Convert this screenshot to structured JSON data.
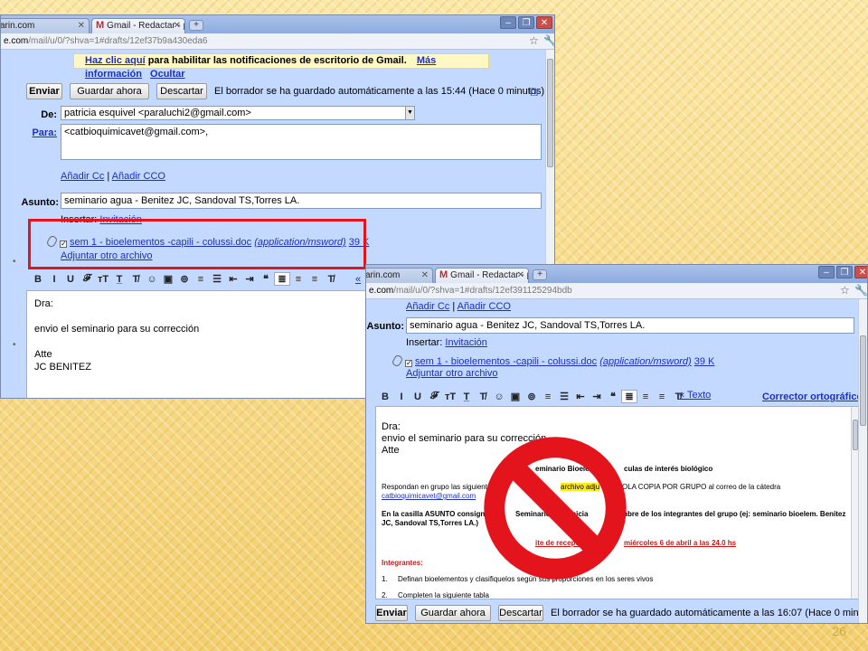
{
  "page_number": "26",
  "window1": {
    "tab_prev": "arin.com",
    "tab_gmail": "Gmail - Redactar - paralu...",
    "url_host": "e.com",
    "url_path": "/mail/u/0/?shva=1#drafts/12ef37b9a430eda6",
    "notification": {
      "link1": "Haz clic aquí",
      "text": "para habilitar las notificaciones de escritorio de Gmail.",
      "link2": "Más información",
      "link3": "Ocultar"
    },
    "actions": {
      "send": "Enviar",
      "save": "Guardar ahora",
      "discard": "Descartar",
      "status": "El borrador se ha guardado automáticamente a las 15:44 (Hace 0 minutos)"
    },
    "from_label": "De:",
    "from_value": "patricia esquivel <paraluchi2@gmail.com>",
    "to_label": "Para:",
    "to_value": "<catbioquimicavet@gmail.com>,",
    "add_cc": "Añadir Cc",
    "sep": "|",
    "add_bcc": "Añadir CCO",
    "subject_label": "Asunto:",
    "subject_value": "seminario agua - Benitez JC, Sandoval TS,Torres LA.",
    "insert_label": "Insertar:",
    "insert_link": "Invitación",
    "attachment_name": "sem 1 - bioelementos -capili - colussi.doc",
    "attachment_type": "(application/msword)",
    "attachment_size": "39 K",
    "attach_another": "Adjuntar otro archivo",
    "toolbar": [
      "B",
      "I",
      "U",
      "𝓕",
      "тT",
      "T̲",
      "T̸",
      "☺",
      "▣",
      "⊚",
      "≡",
      "☰",
      "⇤",
      "⇥",
      "❝",
      "≣",
      "≡",
      "≡",
      "T̸"
    ],
    "text_link": "«",
    "body": [
      "Dra:",
      "envio el seminario para su corrección",
      "Atte",
      "JC BENITEZ"
    ]
  },
  "window2": {
    "tab_prev": "arin.com",
    "tab_gmail": "Gmail - Redactar - paralu...",
    "url_host": "e.com",
    "url_path": "/mail/u/0/?shva=1#drafts/12ef391125294bdb",
    "add_cc": "Añadir Cc",
    "sep": "|",
    "add_bcc": "Añadir CCO",
    "subject_label": "Asunto:",
    "subject_value": "seminario agua - Benitez JC, Sandoval TS,Torres LA.",
    "insert_label": "Insertar:",
    "insert_link": "Invitación",
    "attachment_name": "sem 1 - bioelementos -capili - colussi.doc",
    "attachment_type": "(application/msword)",
    "attachment_size": "39 K",
    "attach_another": "Adjuntar otro archivo",
    "text_link": "« Texto",
    "spellcheck": "Corrector ortográfico ▾",
    "body": {
      "greeting": "Dra:",
      "line1": "envio el seminario para su corrección",
      "sign": "Atte",
      "doc_title_a": "eminario Bioelem",
      "doc_title_b": "culas de interés biológico",
      "doc_p1_a": "Respondan en grupo las siguientes",
      "doc_p1_hl": "archivo adju",
      "doc_p1_b": "OLA COPIA POR GRUPO al correo de la cátedra",
      "doc_email": "catbioquimicavet@gmail.com",
      "doc_p2_a": "En la casilla ASUNTO consignar",
      "doc_p2_b": "Seminario",
      "doc_p2_c": "inicia",
      "doc_p2_d": "ombre  de  los integrantes del grupo (ej: seminario bioelem. Benitez",
      "doc_p2_e": "JC, Sandoval TS,Torres LA.)",
      "doc_deadline_a": "ite de recepc",
      "doc_deadline_b": "miércoles 6 de abril a las  24.0 hs",
      "doc_integrantes": "Integrantes:",
      "doc_item1_n": "1.",
      "doc_item1": "Definan bioelementos y clasifiquelos según sus proporciones en los seres vivos",
      "doc_item2_n": "2.",
      "doc_item2": "Completen la siguiente tabla"
    },
    "actions": {
      "send": "Enviar",
      "save": "Guardar ahora",
      "discard": "Descartar",
      "status": "El borrador se ha guardado automáticamente a las 16:07 (Hace 0 minutos)"
    }
  },
  "colors": {
    "gmail_blue": "#c3d9ff",
    "highlight_red": "#e4141c",
    "no_sign": "#e4141c"
  }
}
